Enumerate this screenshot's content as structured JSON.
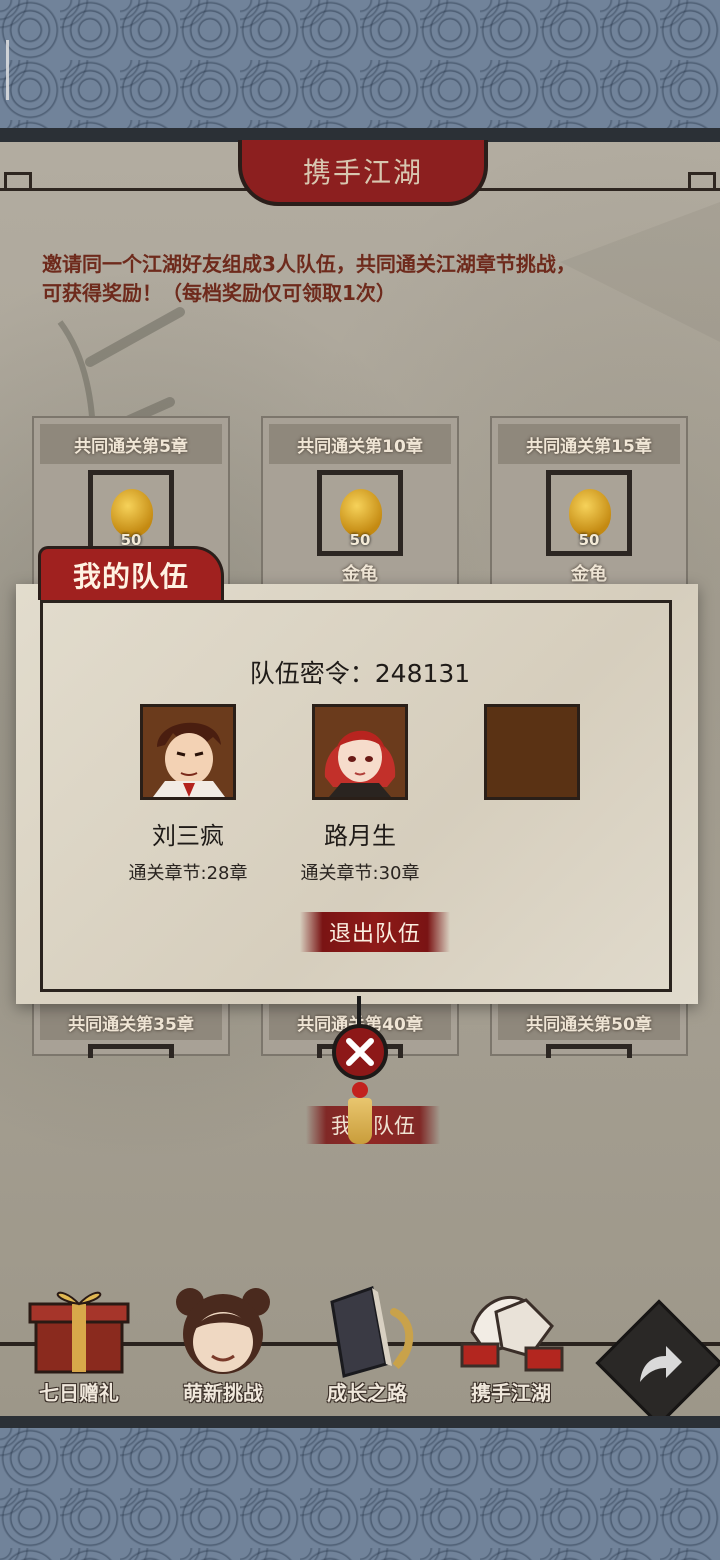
{
  "header": {
    "title": "携手江湖"
  },
  "intro": {
    "line1": "邀请同一个江湖好友组成3人队伍，共同通关江湖章节挑战，",
    "line2": "可获得奖励！（每档奖励仅可领取1次）"
  },
  "rewards_top": [
    {
      "title": "共同通关第5章",
      "count": "50",
      "item": ""
    },
    {
      "title": "共同通关第10章",
      "count": "50",
      "item": "金龟"
    },
    {
      "title": "共同通关第15章",
      "count": "50",
      "item": "金龟"
    }
  ],
  "rewards_bottom": [
    {
      "title": "共同通关第35章"
    },
    {
      "title": "共同通关第40章"
    },
    {
      "title": "共同通关第50章"
    }
  ],
  "modal": {
    "tab_label": "我的队伍",
    "passcode_label": "队伍密令：",
    "passcode_value": "248131",
    "members": [
      {
        "name": "刘三疯",
        "chapter": "通关章节:28章"
      },
      {
        "name": "路月生",
        "chapter": "通关章节:30章"
      }
    ],
    "quit_label": "退出队伍"
  },
  "my_team_label": "我的队伍",
  "nav": [
    {
      "label": "七日赠礼",
      "icon": "gift-box-icon"
    },
    {
      "label": "萌新挑战",
      "icon": "girl-avatar-icon"
    },
    {
      "label": "成长之路",
      "icon": "book-icon"
    },
    {
      "label": "携手江湖",
      "icon": "handshake-icon"
    }
  ],
  "colors": {
    "accent_red": "#8c1f1f",
    "parchment": "#e2dccd",
    "text_dark": "#1f1b18",
    "intro_text": "#6e2a1c"
  }
}
